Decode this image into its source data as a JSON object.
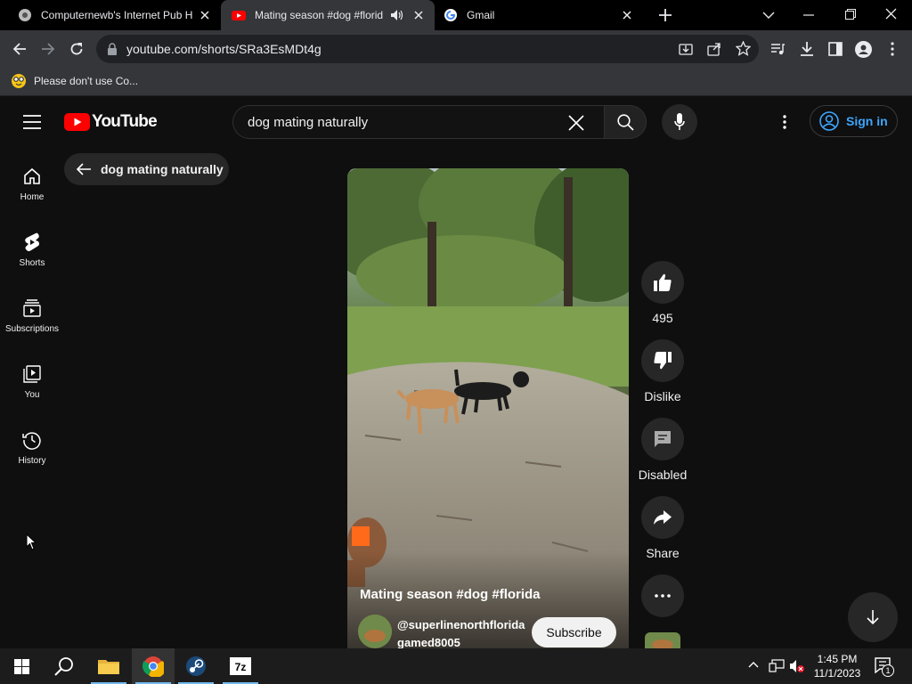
{
  "browser": {
    "tabs": [
      {
        "title": "Computernewb's Internet Pub H"
      },
      {
        "title": "Mating season #dog #florid"
      },
      {
        "title": "Gmail"
      }
    ],
    "url": "youtube.com/shorts/SRa3EsMDt4g",
    "bookmark": "Please don't use Co..."
  },
  "youtube": {
    "logo_text": "YouTube",
    "search_value": "dog mating naturally",
    "signin_label": "Sign in",
    "back_chip_label": "dog mating naturally",
    "guide": [
      {
        "label": "Home",
        "icon": "home-icon"
      },
      {
        "label": "Shorts",
        "icon": "shorts-icon"
      },
      {
        "label": "Subscriptions",
        "icon": "subscriptions-icon"
      },
      {
        "label": "You",
        "icon": "library-icon"
      },
      {
        "label": "History",
        "icon": "history-icon"
      }
    ],
    "short": {
      "title": "Mating season #dog #florida",
      "channel_line1": "@superlinenorthflorida",
      "channel_line2": "gamed8005",
      "subscribe_label": "Subscribe"
    },
    "actions": {
      "like_count": "495",
      "dislike_label": "Dislike",
      "comments_label": "Disabled",
      "share_label": "Share"
    }
  },
  "taskbar": {
    "time": "1:45 PM",
    "date": "11/1/2023",
    "notification_count": "1"
  },
  "colors": {
    "youtube_red": "#ff0000",
    "signin_blue": "#3ea6ff",
    "page_bg": "#0f0f0f"
  }
}
